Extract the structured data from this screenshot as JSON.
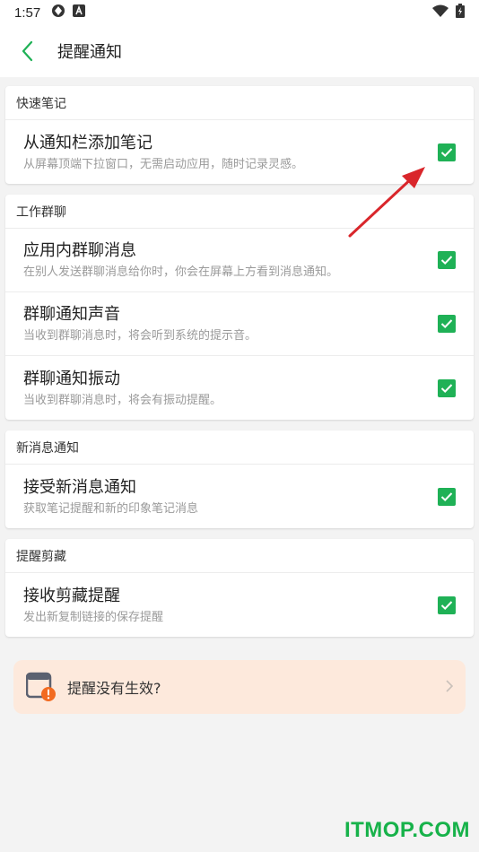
{
  "status": {
    "time": "1:57"
  },
  "header": {
    "title": "提醒通知"
  },
  "sections": [
    {
      "title": "快速笔记",
      "items": [
        {
          "title": "从通知栏添加笔记",
          "subtitle": "从屏幕顶端下拉窗口，无需启动应用，随时记录灵感。",
          "checked": true
        }
      ]
    },
    {
      "title": "工作群聊",
      "items": [
        {
          "title": "应用内群聊消息",
          "subtitle": "在别人发送群聊消息给你时，你会在屏幕上方看到消息通知。",
          "checked": true
        },
        {
          "title": "群聊通知声音",
          "subtitle": "当收到群聊消息时，将会听到系统的提示音。",
          "checked": true
        },
        {
          "title": "群聊通知振动",
          "subtitle": "当收到群聊消息时，将会有振动提醒。",
          "checked": true
        }
      ]
    },
    {
      "title": "新消息通知",
      "items": [
        {
          "title": "接受新消息通知",
          "subtitle": "获取笔记提醒和新的印象笔记消息",
          "checked": true
        }
      ]
    },
    {
      "title": "提醒剪藏",
      "items": [
        {
          "title": "接收剪藏提醒",
          "subtitle": "发出新复制链接的保存提醒",
          "checked": true
        }
      ]
    }
  ],
  "help": {
    "label": "提醒没有生效?"
  },
  "watermark": "ITMOP.COM",
  "colors": {
    "accent": "#1fb156",
    "help_bg": "#fde9dc",
    "annotation_arrow": "#d9262b",
    "watermark": "#17b24a"
  }
}
